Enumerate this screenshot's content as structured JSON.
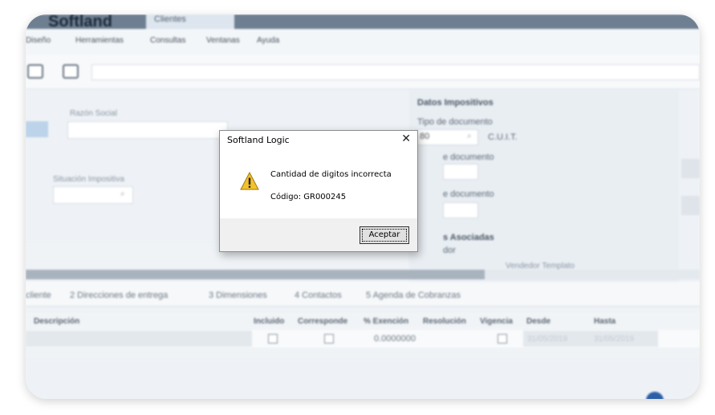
{
  "app": {
    "logo": "Softland",
    "window_tab": "Clientes"
  },
  "menu": [
    {
      "label": "Diseño"
    },
    {
      "label": "Herramientas"
    },
    {
      "label": "Consultas"
    },
    {
      "label": "Ventanas"
    },
    {
      "label": "Ayuda"
    }
  ],
  "form": {
    "razon_social_label": "Razón Social",
    "situacion_label": "Situación Impositiva",
    "datos_title": "Datos Impositivos",
    "tipo_doc_label": "Tipo de documento",
    "tipo_doc_value": "80",
    "tipo_doc_desc": "C.U.I.T.",
    "doc_label_2": "e documento",
    "doc_label_3": "e documento",
    "asociadas_title": "s Asociadas",
    "asociadas_sub": "dor",
    "vendedor_label": "Vendedor Templato"
  },
  "tabs": [
    {
      "label": "cliente"
    },
    {
      "label": "2 Direcciones de entrega"
    },
    {
      "label": "3 Dimensiones"
    },
    {
      "label": "4 Contactos"
    },
    {
      "label": "5 Agenda de Cobranzas"
    }
  ],
  "table": {
    "headers": [
      "Descripción",
      "Incluido",
      "Corresponde",
      "% Exención",
      "Resolución",
      "Vigencia",
      "Desde",
      "Hasta"
    ],
    "row": {
      "exencion": "0.0000000",
      "desde": "31/05/2019",
      "hasta": "31/05/2019"
    }
  },
  "dialog": {
    "title": "Softland Logic",
    "message": "Cantidad de digitos incorrecta",
    "code": "Código: GR000245",
    "button": "Aceptar",
    "close_glyph": "✕",
    "icon": "warning-icon"
  },
  "colors": {
    "accent": "#2b5fa8",
    "warning": "#f2c12e"
  }
}
